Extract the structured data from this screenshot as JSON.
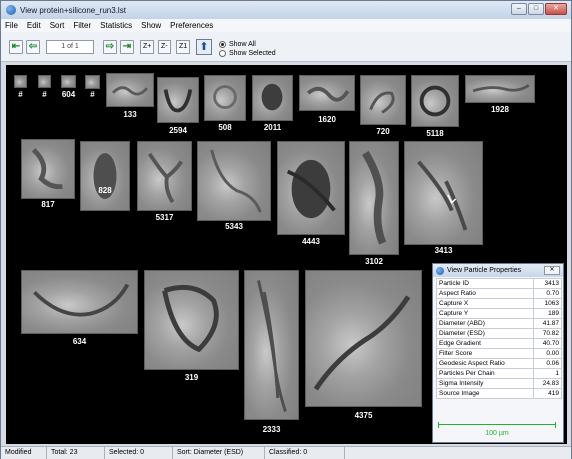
{
  "window": {
    "title": "View  protein+silicone_run3.lst"
  },
  "menu": [
    "File",
    "Edit",
    "Sort",
    "Filter",
    "Statistics",
    "Show",
    "Preferences"
  ],
  "toolbar": {
    "page": "1 of 1",
    "zoom_in": "Z+",
    "zoom_out": "Z-",
    "zoom_one": "Z1",
    "show_all": "Show All",
    "show_selected": "Show Selected"
  },
  "particles": [
    "#",
    "#",
    "604",
    "#",
    "133",
    "2594",
    "508",
    "2011",
    "1620",
    "720",
    "5118",
    "1928",
    "817",
    "828",
    "5317",
    "5343",
    "4443",
    "3102",
    "3413",
    "634",
    "319",
    "2333",
    "4375"
  ],
  "properties": {
    "title": "View Particle Properties",
    "rows": [
      [
        "Particle ID",
        "3413"
      ],
      [
        "Aspect Ratio",
        "0.70"
      ],
      [
        "Capture X",
        "1063"
      ],
      [
        "Capture Y",
        "189"
      ],
      [
        "Diameter (ABD)",
        "41.87"
      ],
      [
        "Diameter (ESD)",
        "70.82"
      ],
      [
        "Edge Gradient",
        "40.70"
      ],
      [
        "Filter Score",
        "0.00"
      ],
      [
        "Geodesic Aspect Ratio",
        "0.06"
      ],
      [
        "Particles Per Chain",
        "1"
      ],
      [
        "Sigma Intensity",
        "24.83"
      ],
      [
        "Source Image",
        "419"
      ]
    ],
    "scale_label": "100 µm"
  },
  "status": {
    "mode": "Modified",
    "total": "Total:  23",
    "selected": "Selected:  0",
    "sort": "Sort: Diameter (ESD)",
    "classified": "Classified:  0"
  }
}
